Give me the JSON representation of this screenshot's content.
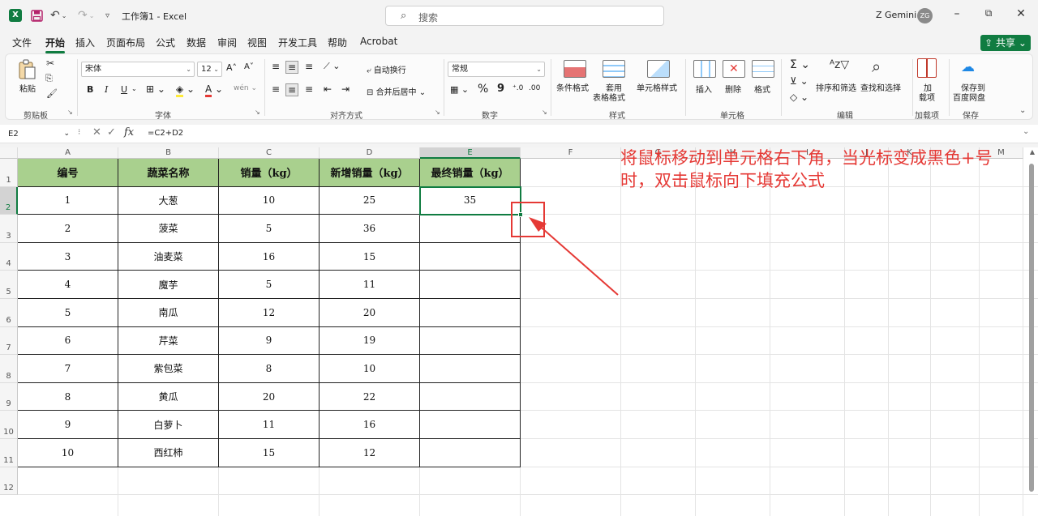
{
  "titlebar": {
    "app_icon": "X",
    "doc_title": "工作簿1 - Excel",
    "search_placeholder": "搜索",
    "user_name": "Z Gemini",
    "avatar_initials": "ZG",
    "icons": [
      "save-icon",
      "undo-icon",
      "redo-icon",
      "customize-qat-icon",
      "minimize-icon",
      "restore-icon",
      "close-icon"
    ]
  },
  "menu": {
    "tabs": [
      "文件",
      "开始",
      "插入",
      "页面布局",
      "公式",
      "数据",
      "审阅",
      "视图",
      "开发工具",
      "帮助",
      "Acrobat"
    ],
    "active": "开始",
    "share_label": "共享"
  },
  "ribbon": {
    "clipboard": {
      "paste": "粘贴",
      "label": "剪贴板"
    },
    "font": {
      "name": "宋体",
      "size": "12",
      "bold": "B",
      "italic": "I",
      "underline": "U",
      "label": "字体"
    },
    "alignment": {
      "wrap": "自动换行",
      "merge": "合并后居中",
      "label": "对齐方式"
    },
    "number": {
      "format": "常规",
      "percent": "%",
      "comma": "9",
      "label": "数字"
    },
    "styles": {
      "conditional": "条件格式",
      "table_1": "套用",
      "table_2": "表格格式",
      "cell_styles": "单元格样式",
      "label": "样式"
    },
    "cells": {
      "insert": "插入",
      "delete": "删除",
      "format": "格式",
      "label": "单元格"
    },
    "editing": {
      "sort": "排序和筛选",
      "find": "查找和选择",
      "label": "编辑"
    },
    "addins": {
      "add_1": "加",
      "add_2": "载项",
      "label": "加载项"
    },
    "save": {
      "save_1": "保存到",
      "save_2": "百度网盘",
      "label": "保存"
    }
  },
  "formula_bar": {
    "name_box": "E2",
    "fx": "fx",
    "formula": "=C2+D2"
  },
  "sheet": {
    "columns": [
      "A",
      "B",
      "C",
      "D",
      "E",
      "F",
      "G",
      "H",
      "I",
      "J",
      "K",
      "L",
      "M"
    ],
    "selected_column": "E",
    "rows": [
      "1",
      "2",
      "3",
      "4",
      "5",
      "6",
      "7",
      "8",
      "9",
      "10",
      "11",
      "12"
    ],
    "selected_row": "2",
    "headers": [
      "编号",
      "蔬菜名称",
      "销量（kg）",
      "新增销量（kg）",
      "最终销量（kg）"
    ],
    "data": [
      [
        "1",
        "大葱",
        "10",
        "25",
        "35"
      ],
      [
        "2",
        "菠菜",
        "5",
        "36",
        ""
      ],
      [
        "3",
        "油麦菜",
        "16",
        "15",
        ""
      ],
      [
        "4",
        "魔芋",
        "5",
        "11",
        ""
      ],
      [
        "5",
        "南瓜",
        "12",
        "20",
        ""
      ],
      [
        "6",
        "芹菜",
        "9",
        "19",
        ""
      ],
      [
        "7",
        "紫包菜",
        "8",
        "10",
        ""
      ],
      [
        "8",
        "黄瓜",
        "20",
        "22",
        ""
      ],
      [
        "9",
        "白萝卜",
        "11",
        "16",
        ""
      ],
      [
        "10",
        "西红柿",
        "15",
        "12",
        ""
      ]
    ],
    "annotation": "将鼠标移动到单元格右下角，当光标变成黑色+号时，双击鼠标向下填充公式",
    "header_fill": "#a9d08e",
    "annotation_color": "#e53935",
    "selection_color": "#107c41"
  }
}
